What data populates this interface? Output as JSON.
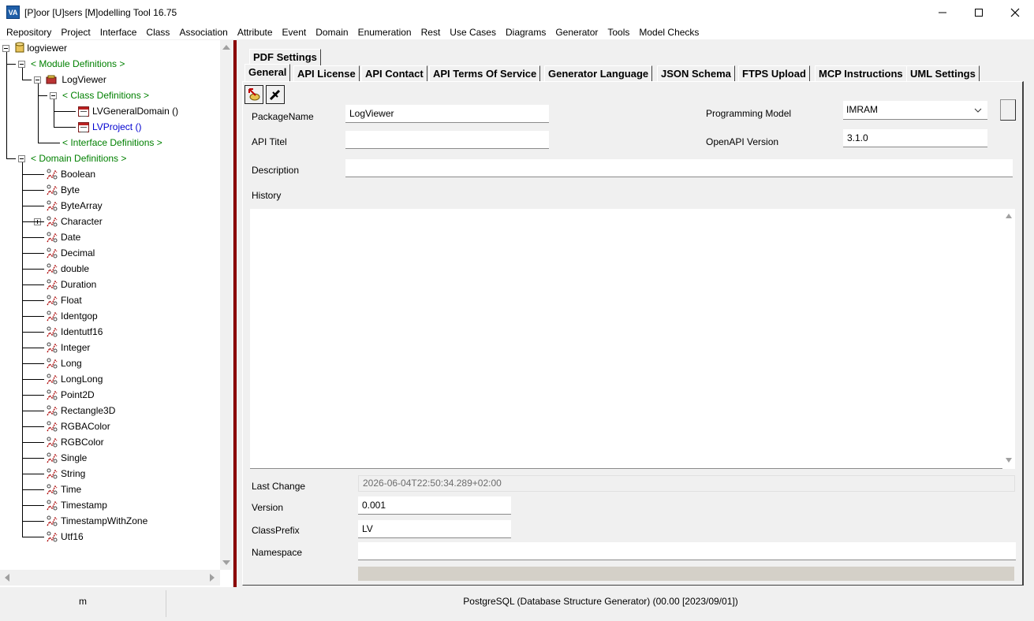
{
  "window": {
    "app_icon": "VA",
    "title": "[P]oor [U]sers [M]odelling Tool 16.75",
    "controls": [
      "minimize-icon",
      "maximize-icon",
      "close-icon"
    ]
  },
  "menu": [
    "Repository",
    "Project",
    "Interface",
    "Class",
    "Association",
    "Attribute",
    "Event",
    "Domain",
    "Enumeration",
    "Rest",
    "Use Cases",
    "Diagrams",
    "Generator",
    "Tools",
    "Model Checks"
  ],
  "tree": {
    "root": "logviewer",
    "module_definitions": "< Module Definitions >",
    "module": "LogViewer",
    "class_definitions": "< Class Definitions >",
    "classes": [
      "LVGeneralDomain ()",
      "LVProject ()"
    ],
    "interface_definitions": "< Interface Definitions >",
    "domain_definitions": "< Domain Definitions >",
    "domains": [
      "Boolean",
      "Byte",
      "ByteArray",
      "Character",
      "Date",
      "Decimal",
      "double",
      "Duration",
      "Float",
      "Identgop",
      "Identutf16",
      "Integer",
      "Long",
      "LongLong",
      "Point2D",
      "Rectangle3D",
      "RGBAColor",
      "RGBColor",
      "Single",
      "String",
      "Time",
      "Timestamp",
      "TimestampWithZone",
      "Utf16"
    ]
  },
  "tabs": {
    "top_row": [
      "PDF Settings"
    ],
    "bottom_row": [
      "General",
      "API License",
      "API Contact",
      "API Terms Of Service",
      "Generator Language",
      "JSON Schema",
      "FTPS Upload",
      "MCP Instructions",
      "UML Settings"
    ],
    "active": "General"
  },
  "form": {
    "package_name_label": "PackageName",
    "package_name_value": "LogViewer",
    "api_title_label": "API Titel",
    "api_title_value": "",
    "programming_model_label": "Programming Model",
    "programming_model_value": "IMRAM",
    "openapi_version_label": "OpenAPI Version",
    "openapi_version_value": "3.1.0",
    "description_label": "Description",
    "description_value": "",
    "history_label": "History",
    "history_value": "",
    "last_change_label": "Last Change",
    "last_change_value": "2026-06-04T22:50:34.289+02:00",
    "version_label": "Version",
    "version_value": "0.001",
    "class_prefix_label": "ClassPrefix",
    "class_prefix_value": "LV",
    "namespace_label": "Namespace",
    "namespace_value": ""
  },
  "status": {
    "left": "m",
    "main": "PostgreSQL (Database Structure Generator) (00.00 [2023/09/01])"
  }
}
